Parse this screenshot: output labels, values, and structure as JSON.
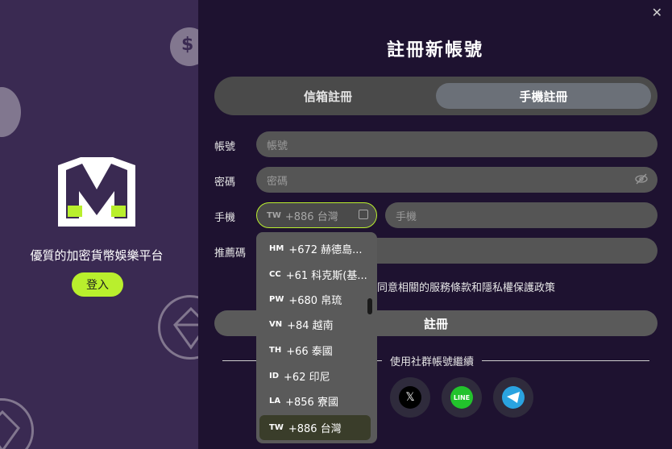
{
  "left_panel": {
    "tagline": "優質的加密貨幣娛樂平台",
    "login_label": "登入"
  },
  "modal": {
    "close_icon": "close-icon",
    "title": "註冊新帳號",
    "tabs": [
      {
        "label": "信箱註冊",
        "active": false
      },
      {
        "label": "手機註冊",
        "active": true
      }
    ],
    "account_label": "帳號",
    "account_placeholder": "帳號",
    "password_label": "密碼",
    "password_placeholder": "密碼",
    "phone_label": "手機",
    "country_code": "TW",
    "country_value": "+886 台灣",
    "phone_placeholder": "手機",
    "referral_label": "推薦碼",
    "agree_text": "同意相關的服務條款和隱私權保護政策",
    "submit_label": "註冊",
    "social_text": "使用社群帳號繼續"
  },
  "dropdown": {
    "items": [
      {
        "code": "HM",
        "label": "+672 赫德島..."
      },
      {
        "code": "CC",
        "label": "+61 科克斯(基..."
      },
      {
        "code": "PW",
        "label": "+680 帛琉"
      },
      {
        "code": "VN",
        "label": "+84 越南"
      },
      {
        "code": "TH",
        "label": "+66 泰國"
      },
      {
        "code": "ID",
        "label": "+62 印尼"
      },
      {
        "code": "LA",
        "label": "+856 寮國"
      },
      {
        "code": "TW",
        "label": "+886 台灣"
      }
    ],
    "selected_index": 7
  },
  "colors": {
    "accent": "#b9ef2d",
    "left_bg": "#3a2a52",
    "right_bg": "#1e1230"
  }
}
